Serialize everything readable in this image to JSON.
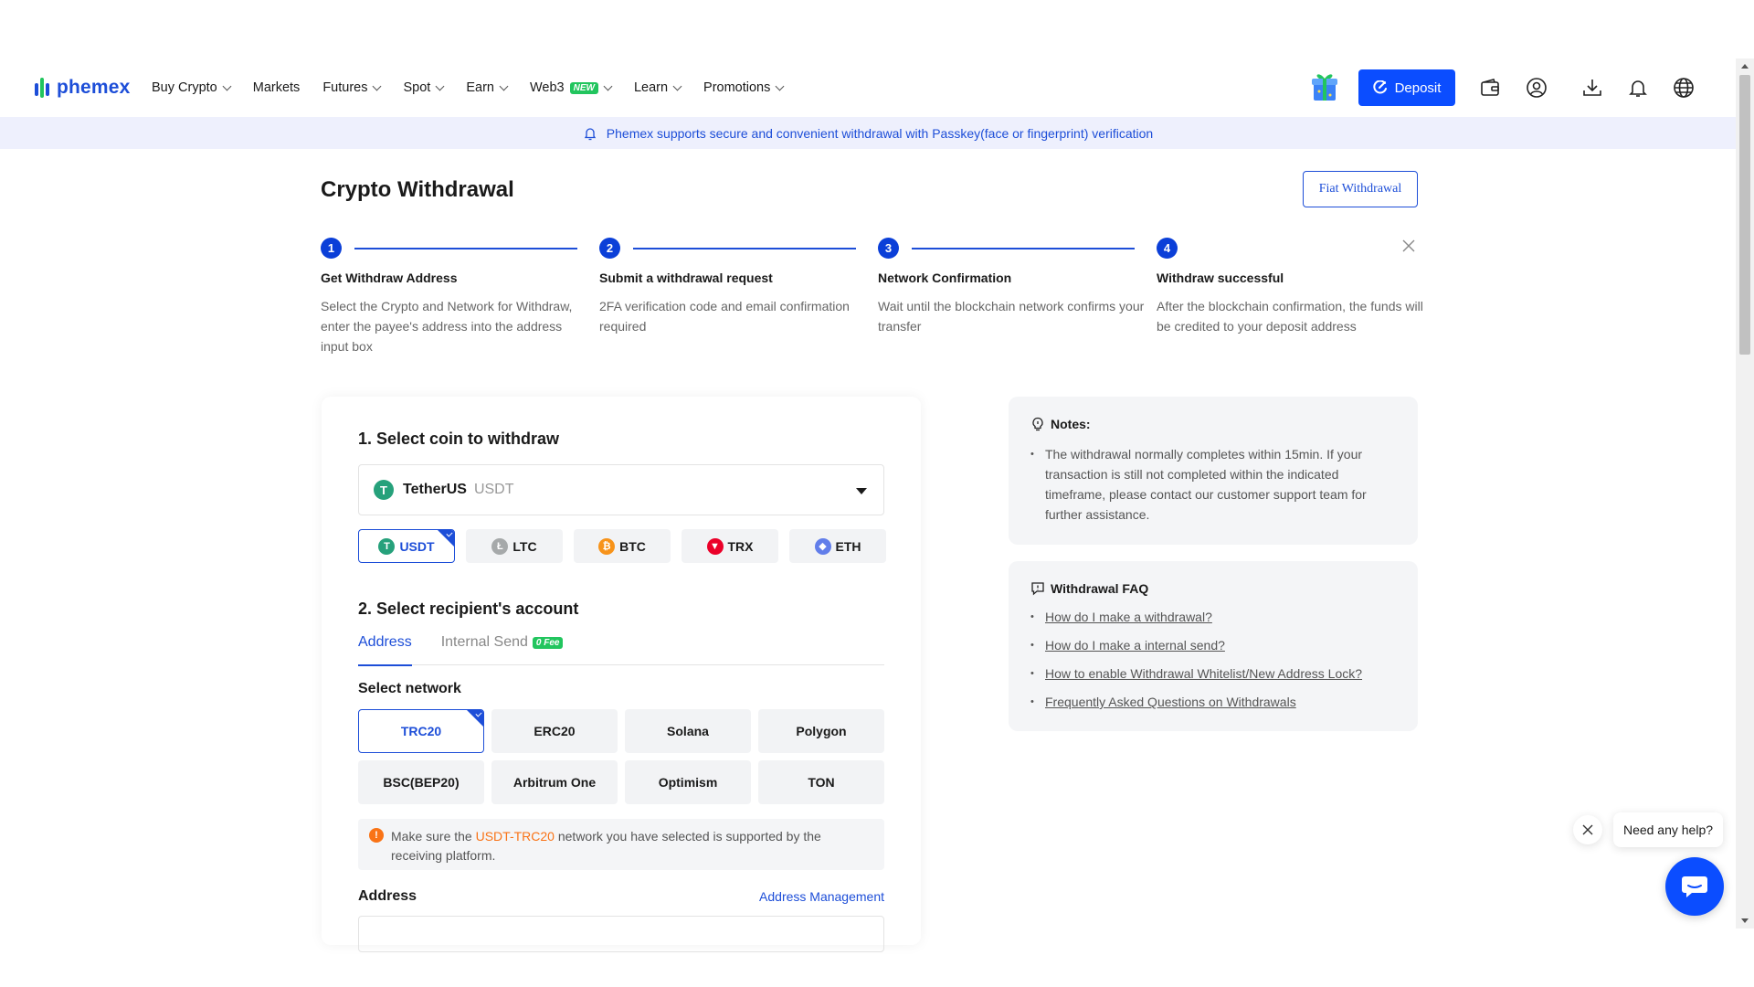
{
  "logo": {
    "text": "phemex"
  },
  "nav": {
    "items": [
      {
        "label": "Buy Crypto",
        "dropdown": true
      },
      {
        "label": "Markets",
        "dropdown": false
      },
      {
        "label": "Futures",
        "dropdown": true
      },
      {
        "label": "Spot",
        "dropdown": true
      },
      {
        "label": "Earn",
        "dropdown": true
      },
      {
        "label": "Web3",
        "dropdown": true,
        "badge": "NEW"
      },
      {
        "label": "Learn",
        "dropdown": true
      },
      {
        "label": "Promotions",
        "dropdown": true
      }
    ],
    "deposit_label": "Deposit",
    "icons": [
      "gift-icon",
      "wallet-icon",
      "user-icon",
      "download-icon",
      "bell-icon",
      "globe-icon"
    ]
  },
  "banner": {
    "text": "Phemex supports secure and convenient withdrawal with Passkey(face or fingerprint) verification"
  },
  "page": {
    "title": "Crypto Withdrawal",
    "fiat_button": "Fiat Withdrawal"
  },
  "steps": [
    {
      "num": "1",
      "title": "Get Withdraw Address",
      "desc": "Select the Crypto and Network for Withdraw, enter the payee's address into the address input box"
    },
    {
      "num": "2",
      "title": "Submit a withdrawal request",
      "desc": "2FA verification code and email confirmation required"
    },
    {
      "num": "3",
      "title": "Network Confirmation",
      "desc": "Wait until the blockchain network confirms your transfer"
    },
    {
      "num": "4",
      "title": "Withdraw successful",
      "desc": "After the blockchain confirmation, the funds will be credited to your deposit address"
    }
  ],
  "form": {
    "section1_title": "1. Select coin to withdraw",
    "selected_coin": {
      "name": "TetherUS",
      "symbol": "USDT"
    },
    "coin_chips": [
      {
        "label": "USDT",
        "color": "#26a17b",
        "glyph": "T",
        "active": true
      },
      {
        "label": "LTC",
        "color": "#a6a9aa",
        "glyph": "Ł",
        "active": false
      },
      {
        "label": "BTC",
        "color": "#f7931a",
        "glyph": "₿",
        "active": false
      },
      {
        "label": "TRX",
        "color": "#eb0029",
        "glyph": "▼",
        "active": false
      },
      {
        "label": "ETH",
        "color": "#627eea",
        "glyph": "◆",
        "active": false
      }
    ],
    "section2_title": "2. Select recipient's account",
    "tabs": {
      "address": "Address",
      "internal": "Internal Send",
      "fee_badge": "0 Fee"
    },
    "network_label": "Select network",
    "networks": [
      {
        "label": "TRC20",
        "active": true
      },
      {
        "label": "ERC20",
        "active": false
      },
      {
        "label": "Solana",
        "active": false
      },
      {
        "label": "Polygon",
        "active": false
      },
      {
        "label": "BSC(BEP20)",
        "active": false
      },
      {
        "label": "Arbitrum One",
        "active": false
      },
      {
        "label": "Optimism",
        "active": false
      },
      {
        "label": "TON",
        "active": false
      }
    ],
    "warning": {
      "pre": "Make sure the ",
      "highlight": "USDT-TRC20",
      "post": " network you have selected is supported by the receiving platform."
    },
    "address_label": "Address",
    "address_mgmt": "Address Management"
  },
  "notes": {
    "title": "Notes:",
    "items": [
      "The withdrawal normally completes within 15min. If your transaction is still not completed within the indicated timeframe, please contact our customer support team for further assistance."
    ]
  },
  "faq": {
    "title": "Withdrawal FAQ",
    "links": [
      "How do I make a withdrawal?",
      "How do I make a internal send?",
      "How to enable Withdrawal Whitelist/New Address Lock?",
      "Frequently Asked Questions on Withdrawals"
    ]
  },
  "help": {
    "bubble": "Need any help?"
  },
  "colors": {
    "accent": "#1d4ed8",
    "deposit": "#0b4dff",
    "warning": "#f97316",
    "success": "#22c55e"
  }
}
